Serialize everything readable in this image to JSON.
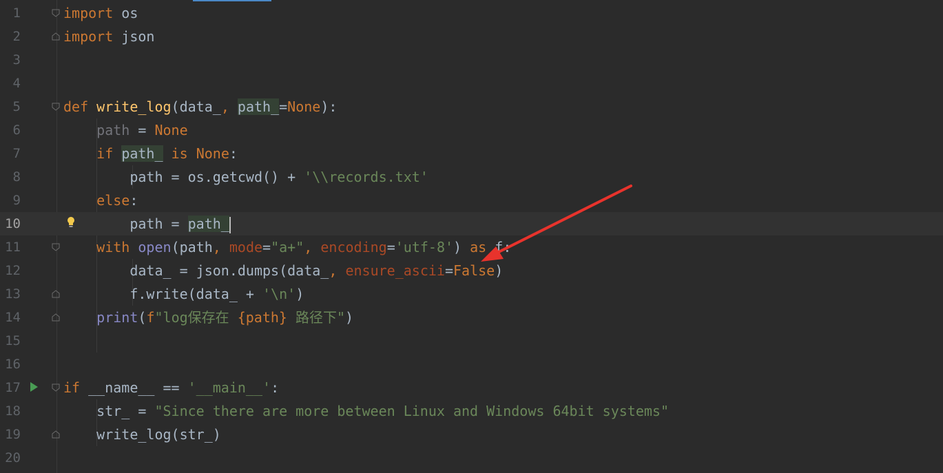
{
  "editor": {
    "language": "python",
    "current_line": 10,
    "colors": {
      "background": "#2b2b2b",
      "keyword": "#cc7832",
      "function": "#ffc66d",
      "string": "#6a8759",
      "builtin": "#8888c6",
      "named_arg": "#aa4926",
      "annotation_arrow": "#e8332c"
    },
    "line_numbers": [
      "1",
      "2",
      "3",
      "4",
      "5",
      "6",
      "7",
      "8",
      "9",
      "10",
      "11",
      "12",
      "13",
      "14",
      "15",
      "16",
      "17",
      "18",
      "19",
      "20"
    ],
    "tokens": {
      "import": "import",
      "os": "os",
      "json": "json",
      "def": "def",
      "write_log": "write_log",
      "data_": "data_",
      "path_": "path_",
      "path": "path",
      "none": "None",
      "if": "if",
      "is": "is",
      "else": "else",
      "with": "with",
      "open": "open",
      "mode": "mode",
      "encoding": "encoding",
      "as": "as",
      "f": "f",
      "json_dumps": "json.dumps",
      "ensure_ascii": "ensure_ascii",
      "false": "False",
      "f_write": "f.write",
      "print": "print",
      "f_prefix": "f",
      "name_dunder": "__name__",
      "str_": "str_",
      "getcwd": "os.getcwd",
      "records_str": "'\\\\records.txt'",
      "mode_val": "\"a+\"",
      "enc_val": "'utf-8'",
      "newline_str": "'\\n'",
      "fstring_a": "\"log保存在 ",
      "fstring_var": "{path}",
      "fstring_b": " 路径下\"",
      "main_str": "'__main__'",
      "since_str": "\"Since there are more between Linux and Windows 64bit systems\""
    },
    "icons": [
      "fold-marker-icon",
      "run-gutter-icon",
      "lightbulb-icon",
      "annotation-arrow"
    ]
  }
}
